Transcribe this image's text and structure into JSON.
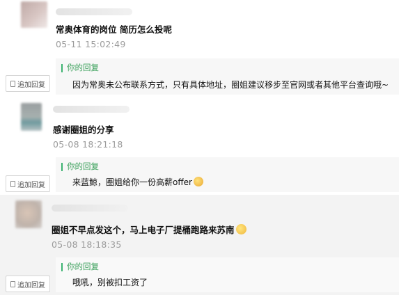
{
  "comments": [
    {
      "text": "常奥体育的岗位 简历怎么投呢",
      "timestamp": "05-11 15:02:49",
      "reply_label": "你的回复",
      "reply_text": "因为常奥未公布联系方式，只有具体地址，圈姐建议移步至官网或者其他平台查询哦~",
      "add_reply_label": "追加回复"
    },
    {
      "text": "感谢圈姐的分享",
      "timestamp": "05-08 18:21:18",
      "reply_label": "你的回复",
      "reply_text": "来蓝鲸，圈姐给你一份高薪offer",
      "add_reply_label": "追加回复"
    },
    {
      "text": "圈姐不早点发这个，马上电子厂提桶跑路来苏南",
      "timestamp": "05-08 18:18:35",
      "reply_label": "你的回复",
      "reply_text": "哦吼，别被扣工资了",
      "add_reply_label": "追加回复"
    }
  ],
  "icons": {
    "reply_emoji": "smug-emoji-icon",
    "comment_emoji": "grin-emoji-icon",
    "add_reply_icon": "document-icon"
  },
  "colors": {
    "accent_green": "#3cb371",
    "timestamp_grey": "#9b9b9b",
    "row_highlight": "#f3f3f3"
  }
}
